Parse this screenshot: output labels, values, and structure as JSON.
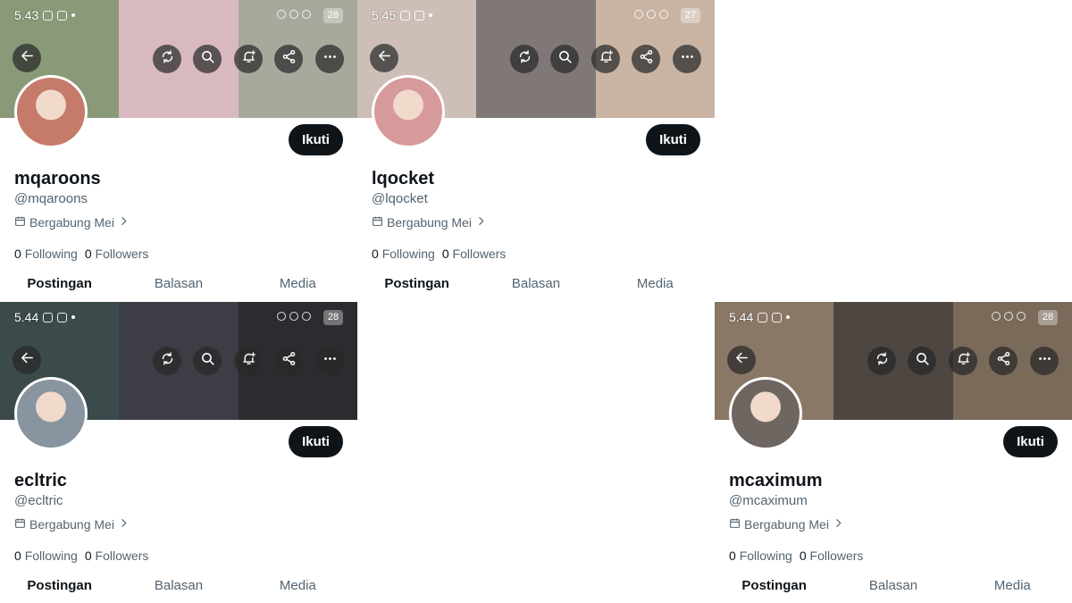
{
  "icons": [
    "back-arrow-icon",
    "repost-icon",
    "search-icon",
    "bell-plus-icon",
    "share-icon",
    "more-icon"
  ],
  "profiles": [
    {
      "status_time": "5.43",
      "battery": "28",
      "banner_colors": [
        "#8a9a78",
        "#d9b9c0",
        "#a8a89c"
      ],
      "avatar_color": "#c67a6a",
      "display_name": "mqaroons",
      "handle": "@mqaroons",
      "joined": "Bergabung Mei",
      "following_count": "0",
      "following_label": "Following",
      "followers_count": "0",
      "followers_label": "Followers",
      "follow_label": "Ikuti",
      "tabs": [
        "Postingan",
        "Balasan",
        "Media"
      ]
    },
    {
      "status_time": "5.45",
      "battery": "27",
      "banner_colors": [
        "#cdbfb8",
        "#7f7877",
        "#c9b4a4"
      ],
      "avatar_color": "#d79a9a",
      "display_name": "lqocket",
      "handle": "@lqocket",
      "joined": "Bergabung Mei",
      "following_count": "0",
      "following_label": "Following",
      "followers_count": "0",
      "followers_label": "Followers",
      "follow_label": "Ikuti",
      "tabs": [
        "Postingan",
        "Balasan",
        "Media"
      ]
    },
    {
      "status_time": "5.44",
      "battery": "28",
      "banner_colors": [
        "#3b4a4a",
        "#3d3d45",
        "#2c2c30"
      ],
      "avatar_color": "#8894a0",
      "display_name": "ecltric",
      "handle": "@ecltric",
      "joined": "Bergabung Mei",
      "following_count": "0",
      "following_label": "Following",
      "followers_count": "0",
      "followers_label": "Followers",
      "follow_label": "Ikuti",
      "tabs": [
        "Postingan",
        "Balasan",
        "Media"
      ]
    },
    {
      "status_time": "5.44",
      "battery": "28",
      "banner_colors": [
        "#8a7866",
        "#4e4640",
        "#7a6a5a"
      ],
      "avatar_color": "#6e6660",
      "display_name": "mcaximum",
      "handle": "@mcaximum",
      "joined": "Bergabung Mei",
      "following_count": "0",
      "following_label": "Following",
      "followers_count": "0",
      "followers_label": "Followers",
      "follow_label": "Ikuti",
      "tabs": [
        "Postingan",
        "Balasan",
        "Media"
      ]
    }
  ]
}
